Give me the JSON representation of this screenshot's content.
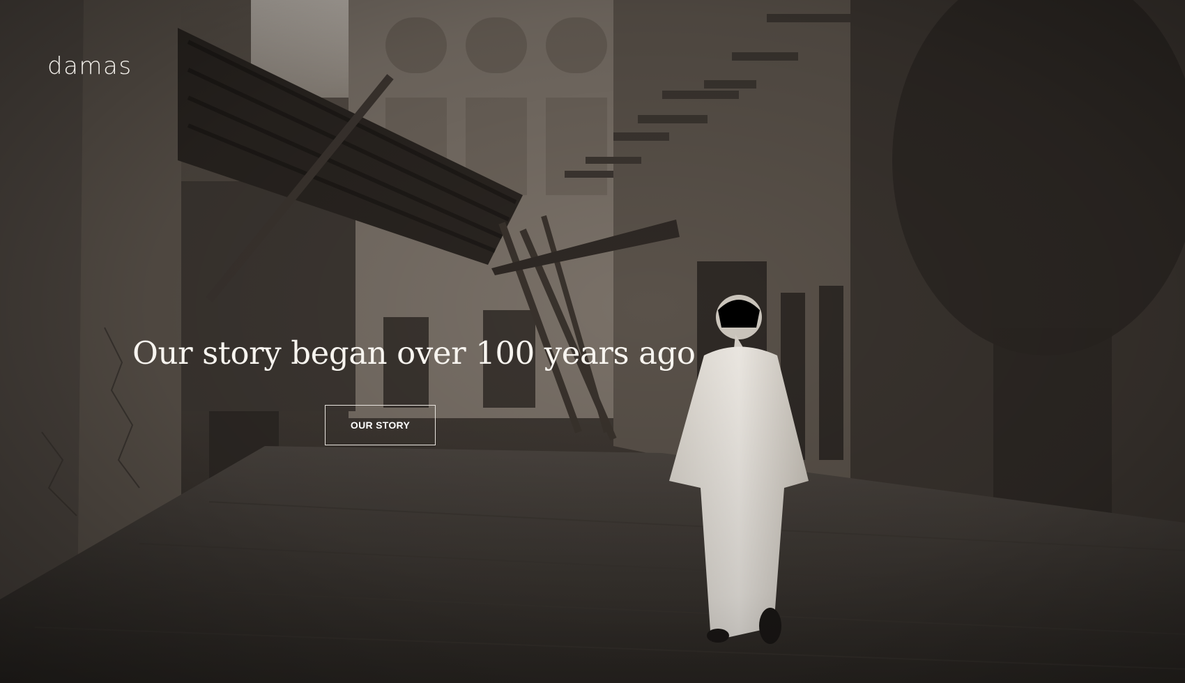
{
  "brand": {
    "logo_text": "damas"
  },
  "hero": {
    "headline": "Our story began over 100 years ago",
    "cta_label": "OUR STORY",
    "image_description_icon": "sepia-photo-old-town-alley"
  },
  "colors": {
    "text": "#f7f4ef",
    "button_border": "#e9e5df",
    "photo_tone": "#4a433c"
  }
}
